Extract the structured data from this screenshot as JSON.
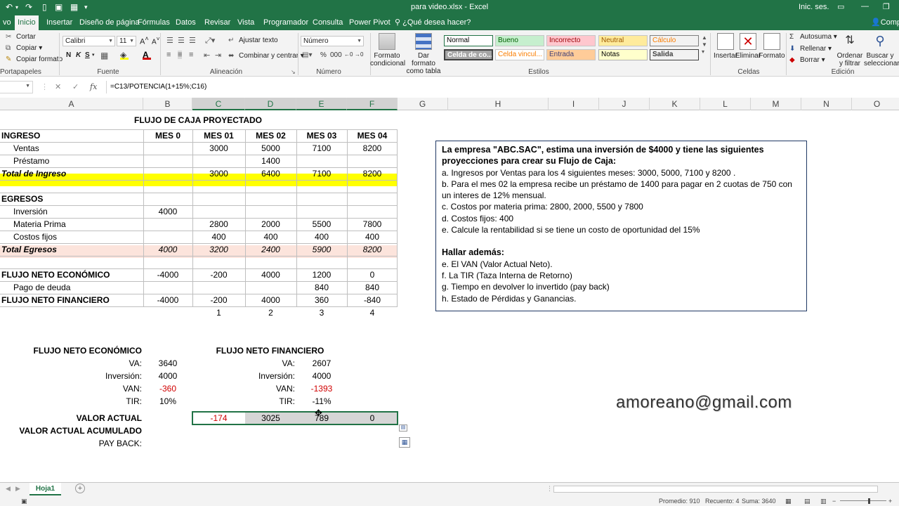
{
  "titlebar": {
    "title": "para video.xlsx  -  Excel",
    "signin": "Inic. ses."
  },
  "tabs": [
    "vo",
    "Inicio",
    "Insertar",
    "Diseño de página",
    "Fórmulas",
    "Datos",
    "Revisar",
    "Vista",
    "Programador",
    "Consulta",
    "Power Pivot"
  ],
  "tellme": "¿Qué desea hacer?",
  "share": "Compartir",
  "ribbon": {
    "clipboard": {
      "cut": "Cortar",
      "copy": "Copiar",
      "format_painter": "Copiar formato",
      "label": "Portapapeles"
    },
    "font": {
      "name": "Calibri",
      "size": "11",
      "label": "Fuente",
      "bold": "N",
      "italic": "K",
      "underline": "S"
    },
    "alignment": {
      "wrap": "Ajustar texto",
      "merge": "Combinar y centrar",
      "label": "Alineación"
    },
    "number": {
      "format": "Número",
      "label": "Número"
    },
    "styles": {
      "conditional": "Formato condicional",
      "as_table": "Dar formato como tabla",
      "label": "Estilos",
      "cells": [
        "Normal",
        "Bueno",
        "Incorrecto",
        "Neutral",
        "Cálculo",
        "Celda de co...",
        "Celda vincul...",
        "Entrada",
        "Notas",
        "Salida"
      ]
    },
    "cells": {
      "insert": "Insertar",
      "delete": "Eliminar",
      "format": "Formato",
      "label": "Celdas"
    },
    "editing": {
      "autosum": "Autosuma",
      "fill": "Rellenar",
      "clear": "Borrar",
      "sort": "Ordenar y filtrar",
      "find": "Buscar y seleccionar",
      "label": "Edición"
    }
  },
  "formula_bar": {
    "name_box": "",
    "formula": "=C13/POTENCIA(1+15%;C16)"
  },
  "columns": [
    "A",
    "B",
    "C",
    "D",
    "E",
    "F",
    "G",
    "H",
    "I",
    "J",
    "K",
    "L",
    "M",
    "N",
    "O"
  ],
  "sheet": {
    "title": "FLUJO DE CAJA PROYECTADO",
    "header": {
      "label": "INGRESO",
      "months": [
        "MES 0",
        "MES 01",
        "MES 02",
        "MES 03",
        "MES 04"
      ]
    },
    "ventas": {
      "label": "Ventas",
      "values": [
        "",
        "3000",
        "5000",
        "7100",
        "8200"
      ]
    },
    "prestamo": {
      "label": "Préstamo",
      "values": [
        "",
        "",
        "1400",
        "",
        ""
      ]
    },
    "total_ingreso": {
      "label": "Total de Ingreso",
      "values": [
        "",
        "3000",
        "6400",
        "7100",
        "8200"
      ]
    },
    "egresos_label": "EGRESOS",
    "inversion": {
      "label": "Inversión",
      "values": [
        "4000",
        "",
        "",
        "",
        ""
      ]
    },
    "materia": {
      "label": "Materia Prima",
      "values": [
        "",
        "2800",
        "2000",
        "5500",
        "7800"
      ]
    },
    "costos": {
      "label": "Costos fijos",
      "values": [
        "",
        "400",
        "400",
        "400",
        "400"
      ]
    },
    "total_egresos": {
      "label": "Total Egresos",
      "values": [
        "4000",
        "3200",
        "2400",
        "5900",
        "8200"
      ]
    },
    "fne": {
      "label": "FLUJO NETO ECONÓMICO",
      "values": [
        "-4000",
        "-200",
        "4000",
        "1200",
        "0"
      ]
    },
    "pago": {
      "label": "Pago de deuda",
      "values": [
        "",
        "",
        "",
        "840",
        "840"
      ]
    },
    "fnf": {
      "label": "FLUJO NETO FINANCIERO",
      "values": [
        "-4000",
        "-200",
        "4000",
        "360",
        "-840"
      ]
    },
    "periods": [
      "1",
      "2",
      "3",
      "4"
    ],
    "summary_econ": {
      "title": "FLUJO NETO ECONÓMICO",
      "va_label": "VA:",
      "va": "3640",
      "inv_label": "Inversión:",
      "inv": "4000",
      "van_label": "VAN:",
      "van": "-360",
      "tir_label": "TIR:",
      "tir": "10%"
    },
    "summary_fin": {
      "title": "FLUJO NETO FINANCIERO",
      "va_label": "VA:",
      "va": "2607",
      "inv_label": "Inversión:",
      "inv": "4000",
      "van_label": "VAN:",
      "van": "-1393",
      "tir_label": "TIR:",
      "tir": "-11%"
    },
    "valor_actual": {
      "label": "VALOR ACTUAL",
      "values": [
        "-174",
        "3025",
        "789",
        "0"
      ]
    },
    "va_acumulado_label": "VALOR ACTUAL ACUMULADO",
    "payback_label": "PAY BACK:"
  },
  "problem": {
    "heading": "La empresa \"ABC.SAC\", estima una inversión de $4000 y tiene las siguientes proyecciones para crear su Flujo de Caja:",
    "items": [
      "a. Ingresos por Ventas para los 4 siguientes meses: 3000, 5000, 7100 y 8200 .",
      "b. Para el mes 02 la empresa recibe un préstamo de 1400 para pagar en 2 cuotas de 750 con un interes de 12% mensual.",
      "c. Costos por materia prima: 2800, 2000, 5500 y 7800",
      "d. Costos fijos: 400",
      "e. Calcule la rentabilidad si se tiene un costo de oportunidad del 15%"
    ],
    "also": "Hallar además:",
    "also_items": [
      "e. El VAN (Valor Actual Neto).",
      "f.  La TIR (Taza Interna de Retorno)",
      "g. Tiempo en devolver lo invertido (pay back)",
      "h. Estado de Pérdidas y Ganancias."
    ]
  },
  "email": "amoreano@gmail.com",
  "sheet_tab": "Hoja1",
  "status": {
    "promedio": "Promedio: 910",
    "recuento": "Recuento: 4",
    "suma": "Suma: 3640"
  },
  "colors": {
    "excel_green": "#217346",
    "yellow_fill": "#ffff00",
    "pink_fill": "#fce4dc",
    "red_text": "#d00000",
    "box_border": "#1f3864"
  }
}
